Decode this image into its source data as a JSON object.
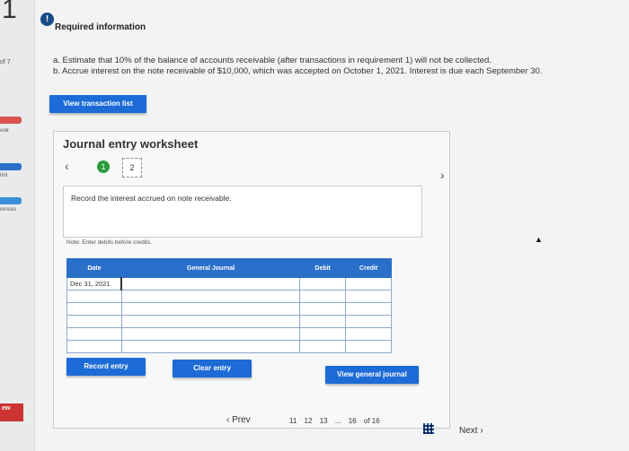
{
  "sidebar": {
    "question_number": "1",
    "of_label": "of 7",
    "labels": [
      "ook",
      "rint",
      "rences"
    ],
    "bottom_badge": "ew"
  },
  "header": {
    "info_icon": "!",
    "title": "Required information"
  },
  "instructions": {
    "a": "a. Estimate that 10% of the balance of accounts receivable (after transactions in requirement 1) will not be collected.",
    "b": "b. Accrue interest on the note receivable of $10,000, which was accepted on October 1, 2021. Interest is due each September 30."
  },
  "buttons": {
    "view_transaction_list": "View transaction list",
    "record_entry": "Record entry",
    "clear_entry": "Clear entry",
    "view_general_journal": "View general journal"
  },
  "worksheet": {
    "title": "Journal entry worksheet",
    "steps": [
      "1",
      "2"
    ],
    "description": "Record the interest accrued on note receivable.",
    "note": "Note: Enter debits before credits.",
    "columns": [
      "Date",
      "General Journal",
      "Debit",
      "Credit"
    ],
    "rows": [
      {
        "date": "Dec 31, 2021",
        "account": "",
        "debit": "",
        "credit": ""
      },
      {
        "date": "",
        "account": "",
        "debit": "",
        "credit": ""
      },
      {
        "date": "",
        "account": "",
        "debit": "",
        "credit": ""
      },
      {
        "date": "",
        "account": "",
        "debit": "",
        "credit": ""
      },
      {
        "date": "",
        "account": "",
        "debit": "",
        "credit": ""
      },
      {
        "date": "",
        "account": "",
        "debit": "",
        "credit": ""
      }
    ]
  },
  "pagination": {
    "prev": "Prev",
    "pages": [
      "11",
      "12",
      "13",
      "...",
      "16"
    ],
    "of_label": "of 16",
    "next": "Next"
  }
}
